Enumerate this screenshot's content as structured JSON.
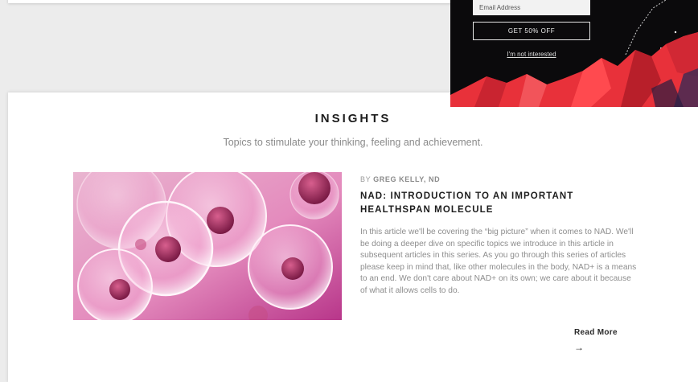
{
  "insights": {
    "title": "INSIGHTS",
    "subtitle": "Topics to stimulate your thinking, feeling and achievement."
  },
  "article": {
    "byline_prefix": "BY ",
    "author": "GREG KELLY, ND",
    "title": "NAD: INTRODUCTION TO AN IMPORTANT HEALTHSPAN MOLECULE",
    "excerpt": "In this article we'll be covering the “big picture” when it comes to NAD. We'll be doing a deeper dive on specific topics we introduce in this article in subsequent articles in this series. As you go through this series of articles please keep in mind that, like other molecules in the body, NAD+ is a means to an end. We don't care about NAD+ on its own; we care about it because of what it allows cells to do.",
    "read_more_label": "Read More",
    "read_more_icon": "arrow-right-icon",
    "read_more_arrow": "→",
    "image_icon": "cells-image"
  },
  "popup": {
    "email_placeholder": "Email Address",
    "email_value": "",
    "cta_label": "GET 50% OFF",
    "decline_label": "I'm not interested",
    "colors": {
      "background": "#0b0a0c",
      "accent_red": "#e8313a"
    }
  }
}
